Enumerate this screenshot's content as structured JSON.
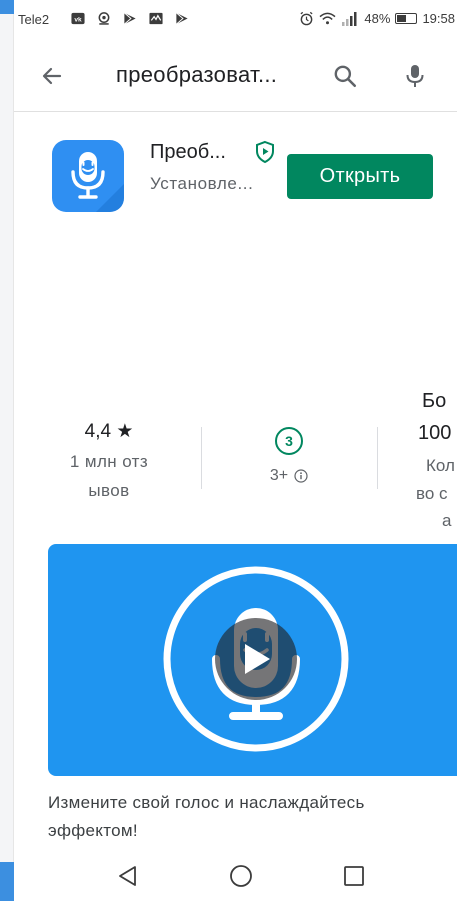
{
  "status_bar": {
    "carrier": "Tele2",
    "battery_level": 0.48,
    "battery_text": "48%",
    "time": "19:58",
    "icons": [
      "vk-icon",
      "link-icon",
      "play-store-icon",
      "activity-icon",
      "play-store-icon",
      "alarm-icon",
      "wifi-icon",
      "signal-icon",
      "battery-icon"
    ]
  },
  "search": {
    "query": "преобразоват...",
    "icons": [
      "arrow-back-icon",
      "search-icon",
      "mic-icon"
    ]
  },
  "app": {
    "title": "Преоб...",
    "status": "Установле...",
    "open_label": "Открыть",
    "colors": {
      "icon_bg": "#2f8ff2",
      "button_bg": "#01875f",
      "verified": "#01875f"
    }
  },
  "stats": {
    "rating_value": "4,4",
    "rating_star": "★",
    "rating_count_line1": "1 млн отз",
    "rating_count_line2": "ывов",
    "age_badge": "3",
    "age_label": "3+",
    "cut_line1": "Бо",
    "cut_line2": "100",
    "cut_line3": "Кол",
    "cut_line4": "во с",
    "cut_line5": "а"
  },
  "promo": {
    "description": "Измените свой голос и наслаждайтесь эффектом!",
    "bg_color": "#1f95f0"
  },
  "navbar": {
    "icons": [
      "nav-back-icon",
      "nav-home-icon",
      "nav-recents-icon"
    ]
  }
}
